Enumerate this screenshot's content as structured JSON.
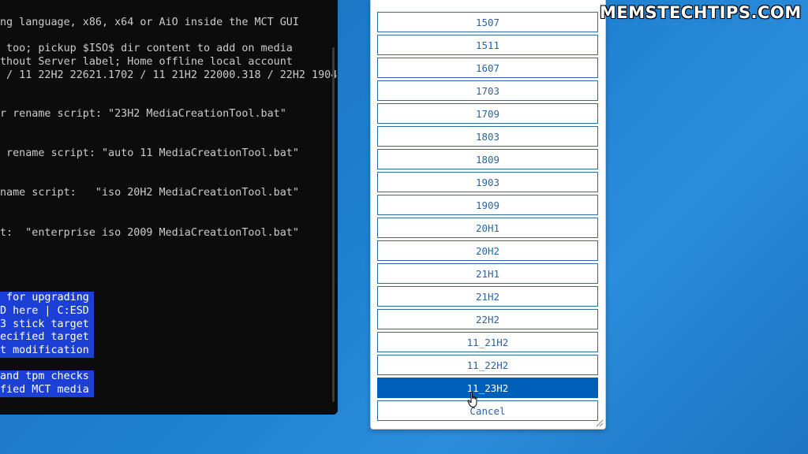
{
  "terminal": {
    "lines": [
      "ng language, x86, x64 or AiO inside the MCT GUI",
      " too; pickup $ISO$ dir content to add on media",
      "thout Server label; Home offline local account",
      " / 11 22H2 22621.1702 / 11 21H2 22000.318 / 22H2 1904",
      "r rename script: \"23H2 MediaCreationTool.bat\"",
      " rename script: \"auto 11 MediaCreationTool.bat\"",
      "name script:   \"iso 20H2 MediaCreationTool.bat\"",
      "t:  \"enterprise iso 2009 MediaCreationTool.bat\""
    ],
    "highlighted": [
      " for upgrading",
      "D here | C:ESD",
      "3 stick target",
      "ecified target",
      "t modification",
      "and tpm checks",
      "fied MCT media"
    ]
  },
  "dialog": {
    "choices": [
      "1507",
      "1511",
      "1607",
      "1703",
      "1709",
      "1803",
      "1809",
      "1903",
      "1909",
      "20H1",
      "20H2",
      "21H1",
      "21H2",
      "22H2",
      "11_21H2",
      "11_22H2",
      "11_23H2"
    ],
    "selected": "11_23H2",
    "cancel_label": "Cancel"
  },
  "watermark": "MEMSTECHTIPS.COM",
  "colors": {
    "selected_bg": "#005fb8",
    "choice_text": "#2a64a6",
    "terminal_highlight": "#1c3fd6"
  }
}
